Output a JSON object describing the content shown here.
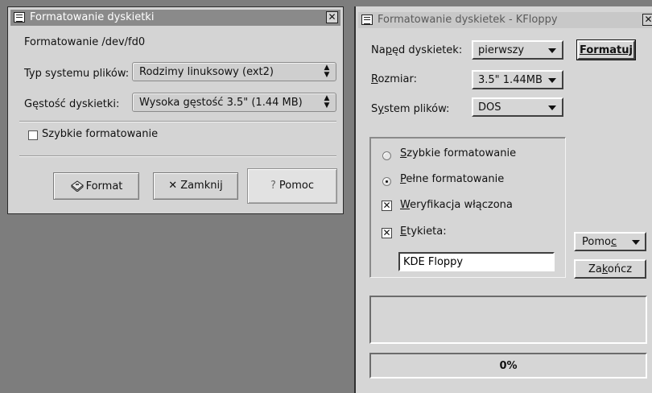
{
  "format_dialog": {
    "title": "Formatowanie dyskietki",
    "close_symbol": "✕",
    "device_line": "Formatowanie /dev/fd0",
    "fs_label": "Typ systemu plików:",
    "fs_value": "Rodzimy linuksowy (ext2)",
    "density_label": "Gęstość dyskietki:",
    "density_value": "Wysoka gęstość 3.5\" (1.44 MB)",
    "quick_format_label": "Szybkie formatowanie",
    "quick_format_checked": false,
    "buttons": {
      "format": "Format",
      "close": "Zamknij",
      "help": "Pomoc"
    },
    "icons": {
      "format": "floppy-disk-icon",
      "close": "x-icon",
      "help": "question-icon"
    }
  },
  "kfloppy": {
    "title": "Formatowanie dyskietek - KFloppy",
    "close_symbol": "✕",
    "drive_label": "Napęd dyskietek:",
    "drive_value": "pierwszy",
    "size_label": "Rozmiar:",
    "size_value": "3.5\" 1.44MB",
    "fs_label": "System plików:",
    "fs_value": "DOS",
    "format_button": "Formatuj",
    "options": {
      "quick": "Szybkie formatowanie",
      "full": "Pełne formatowanie",
      "selected": "full",
      "verify": "Weryfikacja włączona",
      "verify_checked": true,
      "label": "Etykieta:",
      "label_checked": true,
      "label_value": "KDE Floppy"
    },
    "help_button": "Pomoc",
    "quit_button": "Zakończ",
    "progress_text": "0%",
    "progress_value": 0
  }
}
